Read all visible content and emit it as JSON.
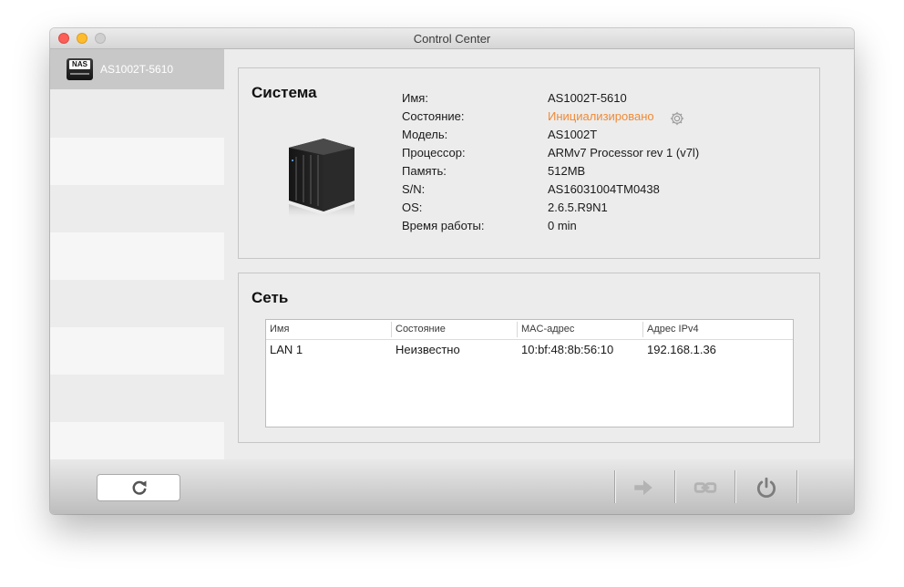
{
  "window": {
    "title": "Control Center"
  },
  "sidebar": {
    "device": {
      "name": "AS1002T-5610",
      "icon": "nas-device-icon",
      "icon_label": "NAS"
    }
  },
  "system": {
    "title": "Система",
    "fields": [
      {
        "label": "Имя:",
        "value": "AS1002T-5610"
      },
      {
        "label": "Состояние:",
        "value": "Инициализировано"
      },
      {
        "label": "Модель:",
        "value": "AS1002T"
      },
      {
        "label": "Процессор:",
        "value": "ARMv7 Processor rev 1 (v7l)"
      },
      {
        "label": "Память:",
        "value": "512MB"
      },
      {
        "label": "S/N:",
        "value": "AS16031004TM0438"
      },
      {
        "label": "OS:",
        "value": "2.6.5.R9N1"
      },
      {
        "label": "Время работы:",
        "value": "0 min"
      }
    ],
    "status_color": "#f08a36"
  },
  "network": {
    "title": "Сеть",
    "columns": [
      "Имя",
      "Состояние",
      "MAC-адрес",
      "Адрес IPv4"
    ],
    "rows": [
      [
        "LAN 1",
        "Неизвестно",
        "10:bf:48:8b:56:10",
        "192.168.1.36"
      ]
    ]
  },
  "toolbar": {
    "refresh_icon": "refresh-icon",
    "connect_icon": "arrow-right-icon",
    "link_icon": "link-icon",
    "power_icon": "power-icon"
  }
}
